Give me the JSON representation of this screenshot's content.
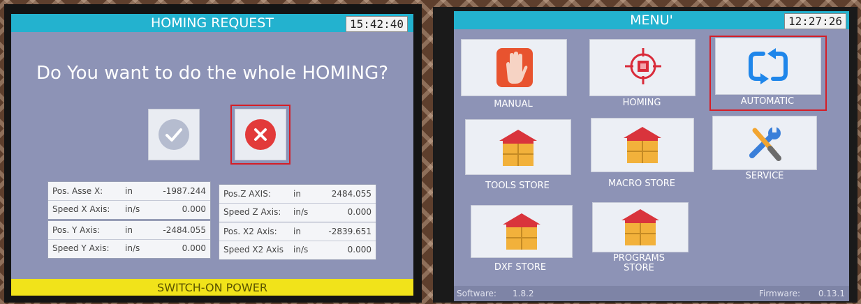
{
  "left_screen": {
    "title": "HOMING REQUEST",
    "clock": "15:42:40",
    "question": "Do You want to do the whole HOMING?",
    "buttons": {
      "confirm_icon": "check-icon",
      "cancel_icon": "close-icon"
    },
    "axes": [
      [
        {
          "label": "Pos. Asse X:",
          "unit": "in",
          "value": "-1987.244"
        },
        {
          "label": "Speed X Axis:",
          "unit": "in/s",
          "value": "0.000"
        }
      ],
      [
        {
          "label": "Pos.Z AXIS:",
          "unit": "in",
          "value": "2484.055"
        },
        {
          "label": "Speed Z Axis:",
          "unit": "in/s",
          "value": "0.000"
        }
      ],
      [
        {
          "label": "Pos. Y Axis:",
          "unit": "in",
          "value": "-2484.055"
        },
        {
          "label": "Speed Y Axis:",
          "unit": "in/s",
          "value": "0.000"
        }
      ],
      [
        {
          "label": "Pos. X2 Axis:",
          "unit": "in",
          "value": "-2839.651"
        },
        {
          "label": "Speed X2 Axis",
          "unit": "in/s",
          "value": "0.000"
        }
      ]
    ],
    "footer": "SWITCH-ON POWER",
    "colors": {
      "title_bar": "#23b2cf",
      "footer_bar": "#f1e31a",
      "background": "#8d93b6",
      "selection": "#d51e27",
      "cancel": "#e23a3a"
    }
  },
  "right_screen": {
    "title": "MENU'",
    "clock": "12:27:26",
    "items": {
      "manual": {
        "label": "MANUAL",
        "icon": "hand-stop-icon"
      },
      "homing": {
        "label": "HOMING",
        "icon": "target-icon"
      },
      "automatic": {
        "label": "AUTOMATIC",
        "icon": "cycle-arrows-icon"
      },
      "tools_store": {
        "label": "TOOLS STORE",
        "icon": "warehouse-icon"
      },
      "macro_store": {
        "label": "MACRO STORE",
        "icon": "warehouse-icon"
      },
      "service": {
        "label": "SERVICE",
        "icon": "wrench-screwdriver-icon"
      },
      "dxf_store": {
        "label": "DXF STORE",
        "icon": "warehouse-icon"
      },
      "programs_store": {
        "label_line1": "PROGRAMS",
        "label_line2": "STORE",
        "icon": "warehouse-icon"
      }
    },
    "software_label": "Software:",
    "software_version": "1.8.2",
    "firmware_label": "Firmware:",
    "firmware_version": "0.13.1"
  }
}
